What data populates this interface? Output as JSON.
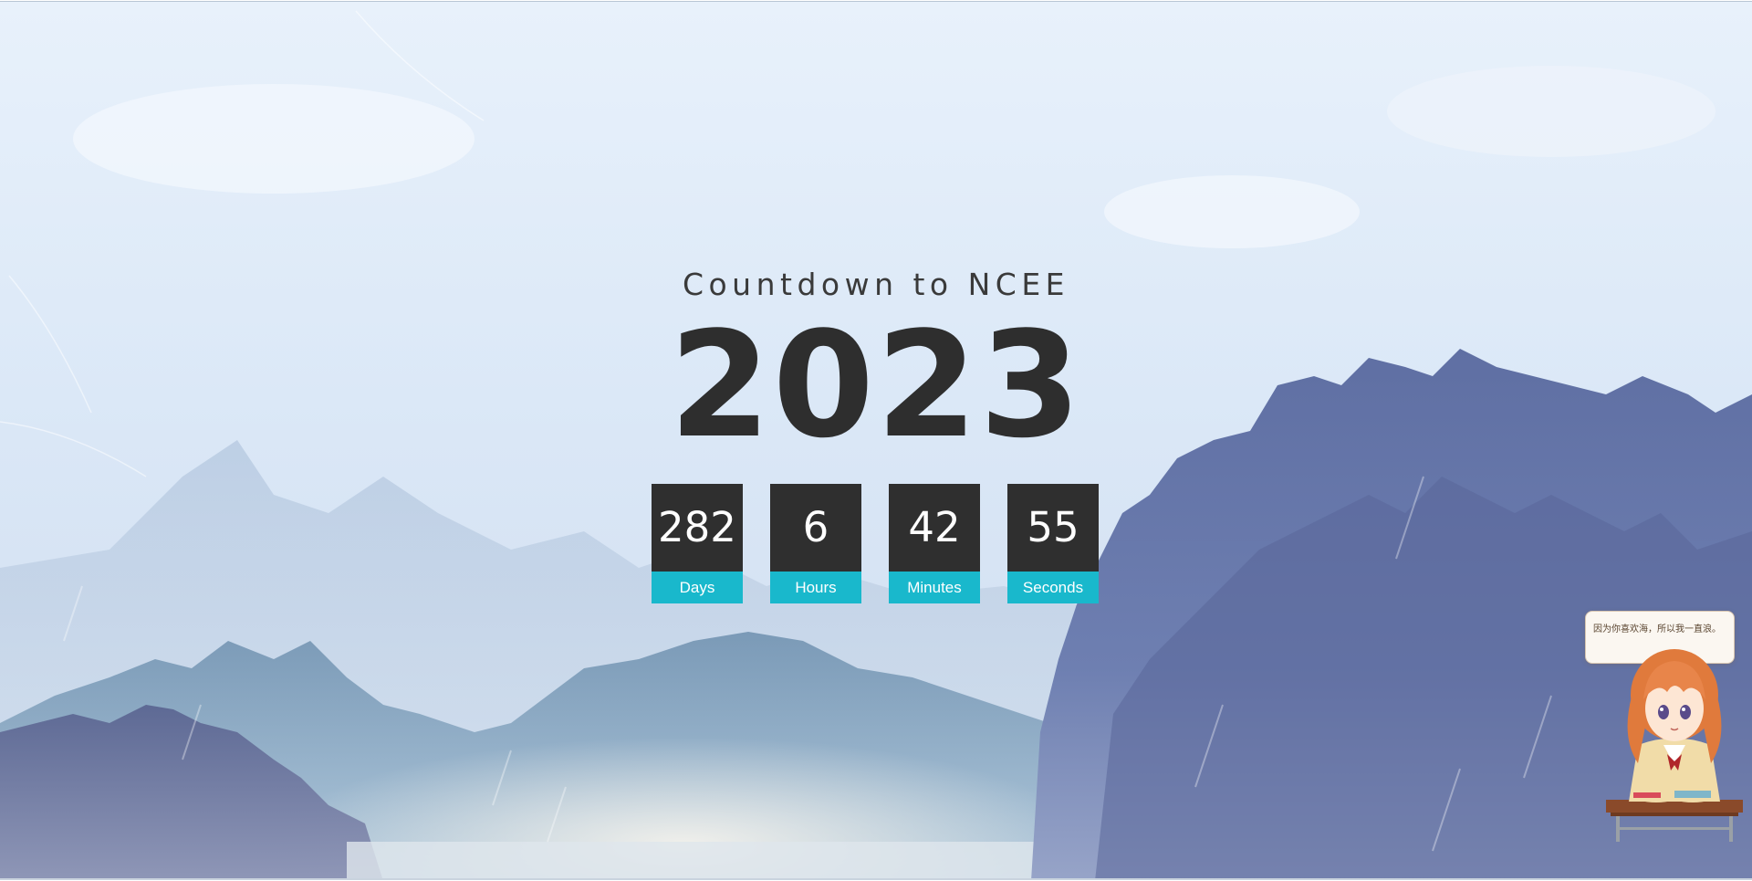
{
  "header": {
    "subtitle": "Countdown to NCEE",
    "year": "2023"
  },
  "countdown": [
    {
      "value": "282",
      "label": "Days"
    },
    {
      "value": "6",
      "label": "Hours"
    },
    {
      "value": "42",
      "label": "Minutes"
    },
    {
      "value": "55",
      "label": "Seconds"
    }
  ],
  "mascot": {
    "message": "因为你喜欢海，所以我一直浪。"
  },
  "colors": {
    "box_bg": "#2f2f2f",
    "label_bg": "#19b8cc",
    "text_dark": "#2e2e2e"
  }
}
